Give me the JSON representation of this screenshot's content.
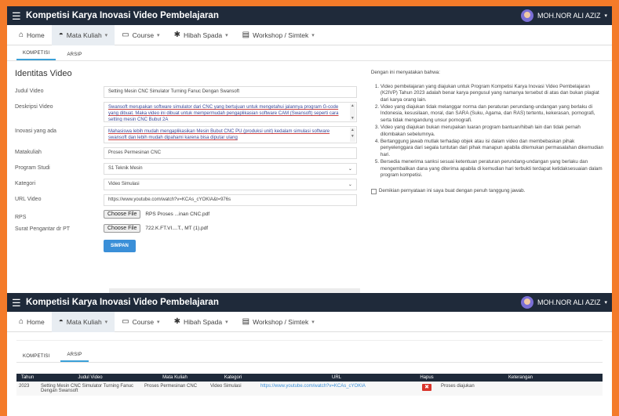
{
  "app_title": "Kompetisi Karya Inovasi Video Pembelajaran",
  "user_name": "MOH.NOR ALI AZIZ",
  "nav": [
    {
      "icon": "home-icon",
      "glyph": "⌂",
      "label": "Home",
      "caret": ""
    },
    {
      "icon": "mortarboard-icon",
      "glyph": "◓",
      "label": "Mata Kuliah",
      "caret": "▾"
    },
    {
      "icon": "monitor-icon",
      "glyph": "▭",
      "label": "Course",
      "caret": "▾"
    },
    {
      "icon": "gift-icon",
      "glyph": "✱",
      "label": "Hibah Spada",
      "caret": "▾"
    },
    {
      "icon": "grid-icon",
      "glyph": "▤",
      "label": "Workshop / Simtek",
      "caret": "▾"
    }
  ],
  "tabs": {
    "kompetisi": "KOMPETISI",
    "arsip": "ARSIP"
  },
  "form": {
    "section_title": "Identitas Video",
    "judul_label": "Judul Video",
    "judul_value": "Setting Mesin CNC Simulator Turning Fanuc Dengan Swansoft",
    "deskripsi_label": "Deskripsi Video",
    "deskripsi_value": "Swansoft merupakan software simulator dari CNC yang bertujuan untuk mengetahui jalannya program G-code yang dibuat. Maka video ini dibuat untuk mempermudah pengaplikasian software CAM (Swansoft) seperti cara setting mesin CNC Bubut 2A",
    "inovasi_label": "Inovasi yang ada",
    "inovasi_value": "Mahasiswa lebih mudah mengaplikasikan Mesin Bubut CNC PU (produksi unit) kedalam simulasi software swansoft dan lebih mudah dipahami karena bisa diputar ulang",
    "matakuliah_label": "Matakuliah",
    "matakuliah_value": "Proses Permesinan CNC",
    "prodi_label": "Program Studi",
    "prodi_value": "S1 Teknik Mesin",
    "kategori_label": "Kategori",
    "kategori_value": "Video Simulasi",
    "url_label": "URL Video",
    "url_value": "https://www.youtube.com/watch?v=KCAs_cYOKIA&t=976s",
    "rps_label": "RPS",
    "choose_file": "Choose File",
    "rps_file": "RPS Proses ...inan CNC.pdf",
    "surat_label": "Surat Pengantar dr PT",
    "surat_file": "722.K.FT.VI....T., MT (1).pdf",
    "submit": "SIMPAN"
  },
  "statement": {
    "intro": "Dengan ini menyatakan bahwa:",
    "items": [
      "Video pembelajaran yang diajukan untuk Program Kompetisi Karya Inovasi Video Pembelajaran (K2IVP) Tahun 2023 adalah benar karya pengusul yang namanya tersebut di atas dan bukan plagiat dari karya orang lain.",
      "Video yang diajukan tidak melanggar norma dan peraturan perundang-undangan yang berlaku di Indonesia, kesusilaan, moral, dan SARA (Suku, Agama, dan RAS) tertentu, kekerasan, pornografi, serta tidak mengandung unsur pornografi.",
      "Video yang diajukan bukan merupakan luaran program bantuan/hibah lain dan tidak pernah dilombakan sebelumnya.",
      "Bertanggung jawab mutlak terhadap objek atau isi dalam video dan membebaskan pihak penyelenggara dari segala tuntutan dari pihak manapun apabila ditemukan permasalahan dikemudian hari.",
      "Bersedia menerima sanksi sesuai ketentuan peraturan perundang-undangan yang berlaku dan mengembalikan dana yang diterima apabila di kemudian hari terbukti terdapat ketidaksesuaian dalam program kompetisi."
    ],
    "checkbox_label": "Demikian pernyataan ini saya buat dengan penuh tanggung jawab."
  },
  "table": {
    "headers": [
      "Tahun",
      "Judul Video",
      "Mata Kuliah",
      "Kategori",
      "URL",
      "Hapus",
      "Keterangan"
    ],
    "row": {
      "tahun": "2023",
      "judul": "Setting Mesin CNC Simulator Turning Fanuc Dengan Swansoft",
      "matkul": "Proses Permesinan CNC",
      "kategori": "Video Simulasi",
      "url": "https://www.youtube.com/watch?v=KCAs_cYOKIA",
      "hapus": "✖",
      "keterangan": "Proses diajukan"
    }
  },
  "colors": {
    "topbar": "#1f2a3a",
    "accent": "#3a8fd8",
    "delete": "#d9342b",
    "frame": "#f47b2a"
  }
}
